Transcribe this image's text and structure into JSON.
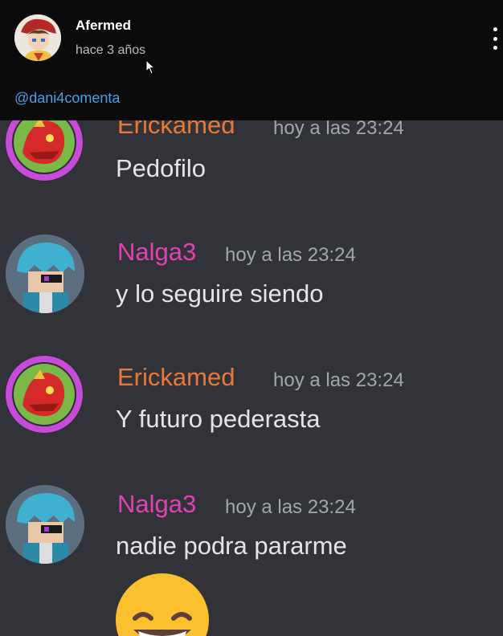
{
  "post": {
    "author": "Afermed",
    "time": "hace 3 años",
    "mention": "@dani4comenta"
  },
  "colors": {
    "author_erick": "#e8793a",
    "author_nalga": "#e440b6",
    "background": "#313338",
    "mention": "#4a9fe8"
  },
  "messages": [
    {
      "author": "Erickamed",
      "time": "hoy a las 23:24",
      "text": "Pedofilo"
    },
    {
      "author": "Nalga3",
      "time": "hoy a las 23:24",
      "text": "y lo seguire siendo"
    },
    {
      "author": "Erickamed",
      "time": "hoy a las 23:24",
      "text": "Y futuro pederasta"
    },
    {
      "author": "Nalga3",
      "time": "hoy a las 23:24",
      "text": "nadie podra pararme"
    }
  ],
  "icons": [
    "user-avatar",
    "more-options-icon",
    "cursor-arrow-icon",
    "grinning-emoji"
  ]
}
